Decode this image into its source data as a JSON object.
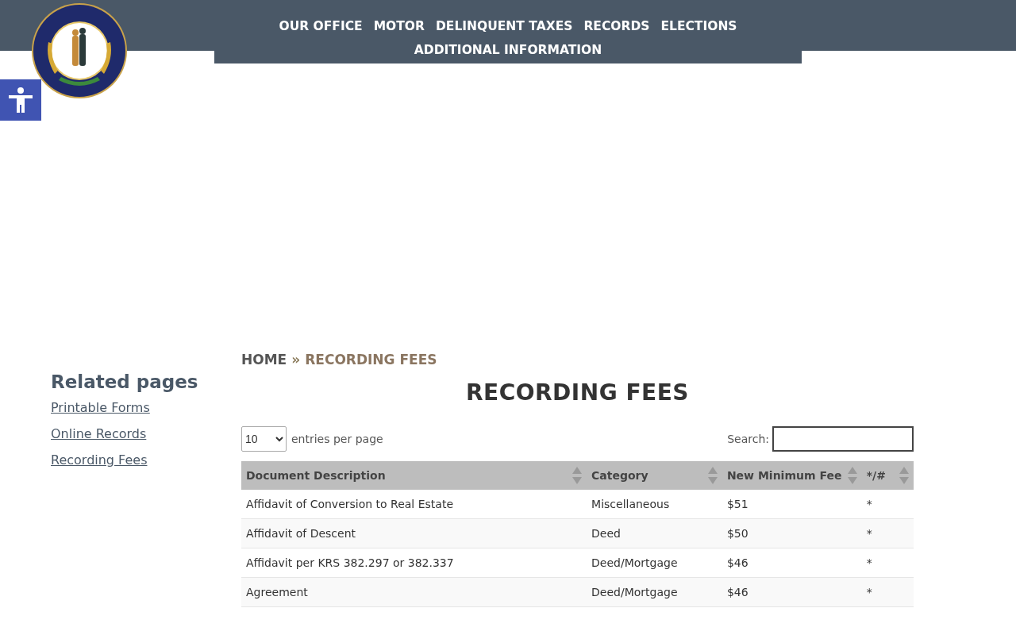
{
  "nav": {
    "items": [
      {
        "label": "OUR OFFICE"
      },
      {
        "label": "MOTOR"
      },
      {
        "label": "DELINQUENT TAXES"
      },
      {
        "label": "RECORDS"
      },
      {
        "label": "ELECTIONS"
      },
      {
        "label": "ADDITIONAL INFORMATION"
      }
    ]
  },
  "sidebar": {
    "title": "Related pages",
    "links": [
      {
        "label": "Printable Forms"
      },
      {
        "label": "Online Records"
      },
      {
        "label": "Recording Fees"
      }
    ]
  },
  "breadcrumb": {
    "home": "HOME",
    "separator": "»",
    "current": "RECORDING FEES"
  },
  "page_title": "RECORDING FEES",
  "table_controls": {
    "page_size": "10",
    "page_size_label": "entries per page",
    "search_label": "Search:"
  },
  "table": {
    "columns": [
      "Document Description",
      "Category",
      "New Minimum Fee",
      "*/#"
    ],
    "rows": [
      [
        "Affidavit of Conversion to Real Estate",
        "Miscellaneous",
        "$51",
        "*"
      ],
      [
        "Affidavit of Descent",
        "Deed",
        "$50",
        "*"
      ],
      [
        "Affidavit per KRS 382.297 or 382.337",
        "Deed/Mortgage",
        "$46",
        "*"
      ],
      [
        "Agreement",
        "Deed/Mortgage",
        "$46",
        "*"
      ]
    ]
  }
}
